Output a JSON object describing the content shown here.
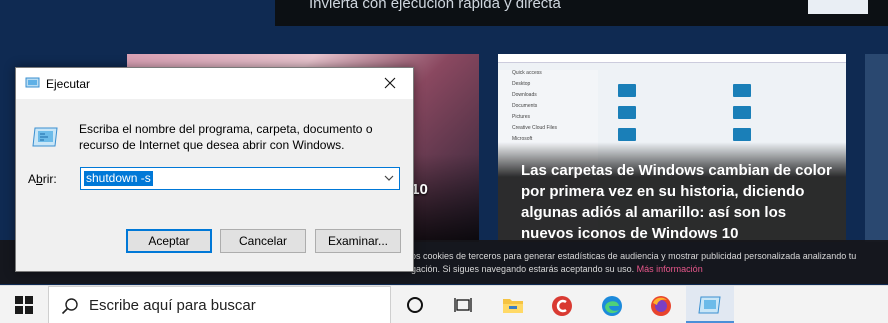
{
  "background_page": {
    "banner_text": "Invierta con ejecución rápida y directa",
    "card_left_title": "ws 10\nen",
    "card_right_title": "Las carpetas de Windows cambian de color por primera vez en su historia, diciendo algunas adiós al amarillo: así son los nuevos iconos de Windows 10",
    "explorer_nav": [
      "Quick access",
      "Desktop",
      "Downloads",
      "Documents",
      "Pictures",
      "Creative Cloud Files",
      "Microsoft"
    ],
    "explorer_folders": [
      "Desktop",
      "Documents",
      "Downloads",
      "Music",
      "Pictures",
      "Videos"
    ],
    "cookie_line1": "os cookies de terceros para generar estadísticas de audiencia y mostrar publicidad personalizada analizando tu",
    "cookie_line2": "gación. Si sigues navegando estarás aceptando su uso.",
    "cookie_more": "Más información"
  },
  "run_dialog": {
    "title": "Ejecutar",
    "description": "Escriba el nombre del programa, carpeta, documento o recurso de Internet que desea abrir con Windows.",
    "open_label_prefix": "A",
    "open_label_underlined": "b",
    "open_label_suffix": "rir:",
    "command_value": "shutdown -s",
    "buttons": {
      "ok": "Aceptar",
      "cancel": "Cancelar",
      "browse": "Examinar..."
    }
  },
  "taskbar": {
    "search_placeholder": "Escribe aquí para buscar",
    "icons": [
      "cortana-icon",
      "task-view-icon",
      "file-explorer-icon",
      "ccleaner-icon",
      "edge-icon",
      "firefox-icon",
      "run-icon"
    ]
  },
  "colors": {
    "accent": "#0078d7",
    "page_background": "#0f2a52",
    "link": "#e8578b"
  }
}
